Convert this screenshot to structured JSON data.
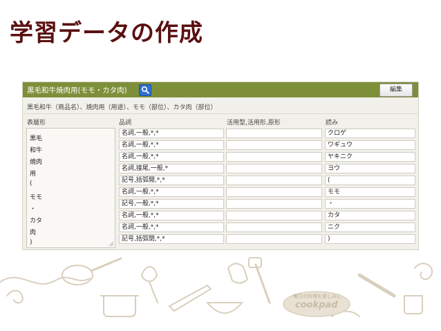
{
  "slide": {
    "title": "学習データの作成"
  },
  "panel": {
    "header_title": "黒毛和牛焼肉用(モモ・カタ肉)",
    "edit_label": "編集",
    "description": "黒毛和牛（商品名）、焼肉用（用途）、モモ（部位）、カタ肉（部位）",
    "columns": {
      "surface": "表層形",
      "pos": "品詞",
      "conjugation": "活用型,活用形,原形",
      "reading": "読み"
    },
    "surface_lines": [
      "黒毛",
      "和牛",
      "焼肉",
      "用",
      "(",
      "モモ",
      "・",
      "カタ",
      "肉",
      ")"
    ],
    "rows": [
      {
        "pos": "名詞,一般,*,*",
        "conj": "",
        "reading": "クロゲ"
      },
      {
        "pos": "名詞,一般,*,*",
        "conj": "",
        "reading": "ワギュウ"
      },
      {
        "pos": "名詞,一般,*,*",
        "conj": "",
        "reading": "ヤキニク"
      },
      {
        "pos": "名詞,接尾,一般,*",
        "conj": "",
        "reading": "ヨウ"
      },
      {
        "pos": "記号,括弧開,*,*",
        "conj": "",
        "reading": "("
      },
      {
        "pos": "名詞,一般,*,*",
        "conj": "",
        "reading": "モモ"
      },
      {
        "pos": "記号,一般,*,*",
        "conj": "",
        "reading": "・"
      },
      {
        "pos": "名詞,一般,*,*",
        "conj": "",
        "reading": "カタ"
      },
      {
        "pos": "名詞,一般,*,*",
        "conj": "",
        "reading": "ニク"
      },
      {
        "pos": "記号,括弧閉,*,*",
        "conj": "",
        "reading": ")"
      }
    ]
  },
  "footer": {
    "tagline": "毎日の料理を楽しみに",
    "logo_text": "cookpad"
  },
  "colors": {
    "title": "#5a1010",
    "header_bar": "#7e8f3a",
    "search_button": "#2d6fd1",
    "decoration": "#d9cfbd"
  }
}
